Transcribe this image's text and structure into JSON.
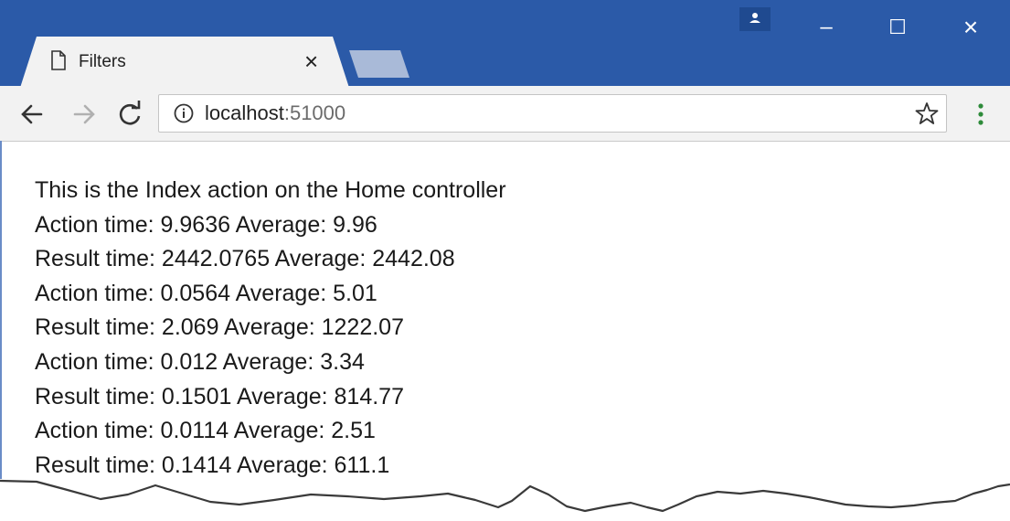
{
  "browser": {
    "tab": {
      "title": "Filters",
      "close_glyph": "×",
      "icon": "page-icon"
    },
    "window_controls": {
      "minimize": "–",
      "maximize": "☐",
      "close": "×"
    },
    "address": {
      "host": "localhost",
      "port": ":51000"
    },
    "icons": [
      "back-icon",
      "forward-icon",
      "reload-icon",
      "info-icon",
      "star-icon",
      "menu-icon",
      "profile-icon"
    ],
    "colors": {
      "titlebar": "#2b5aa8",
      "toolbar": "#f2f2f2"
    }
  },
  "page": {
    "lines": [
      "This is the Index action on the Home controller",
      "Action time: 9.9636 Average: 9.96",
      "Result time: 2442.0765 Average: 2442.08",
      "Action time: 0.0564 Average: 5.01",
      "Result time: 2.069 Average: 1222.07",
      "Action time: 0.012 Average: 3.34",
      "Result time: 0.1501 Average: 814.77",
      "Action time: 0.0114 Average: 2.51",
      "Result time: 0.1414 Average: 611.1"
    ]
  }
}
